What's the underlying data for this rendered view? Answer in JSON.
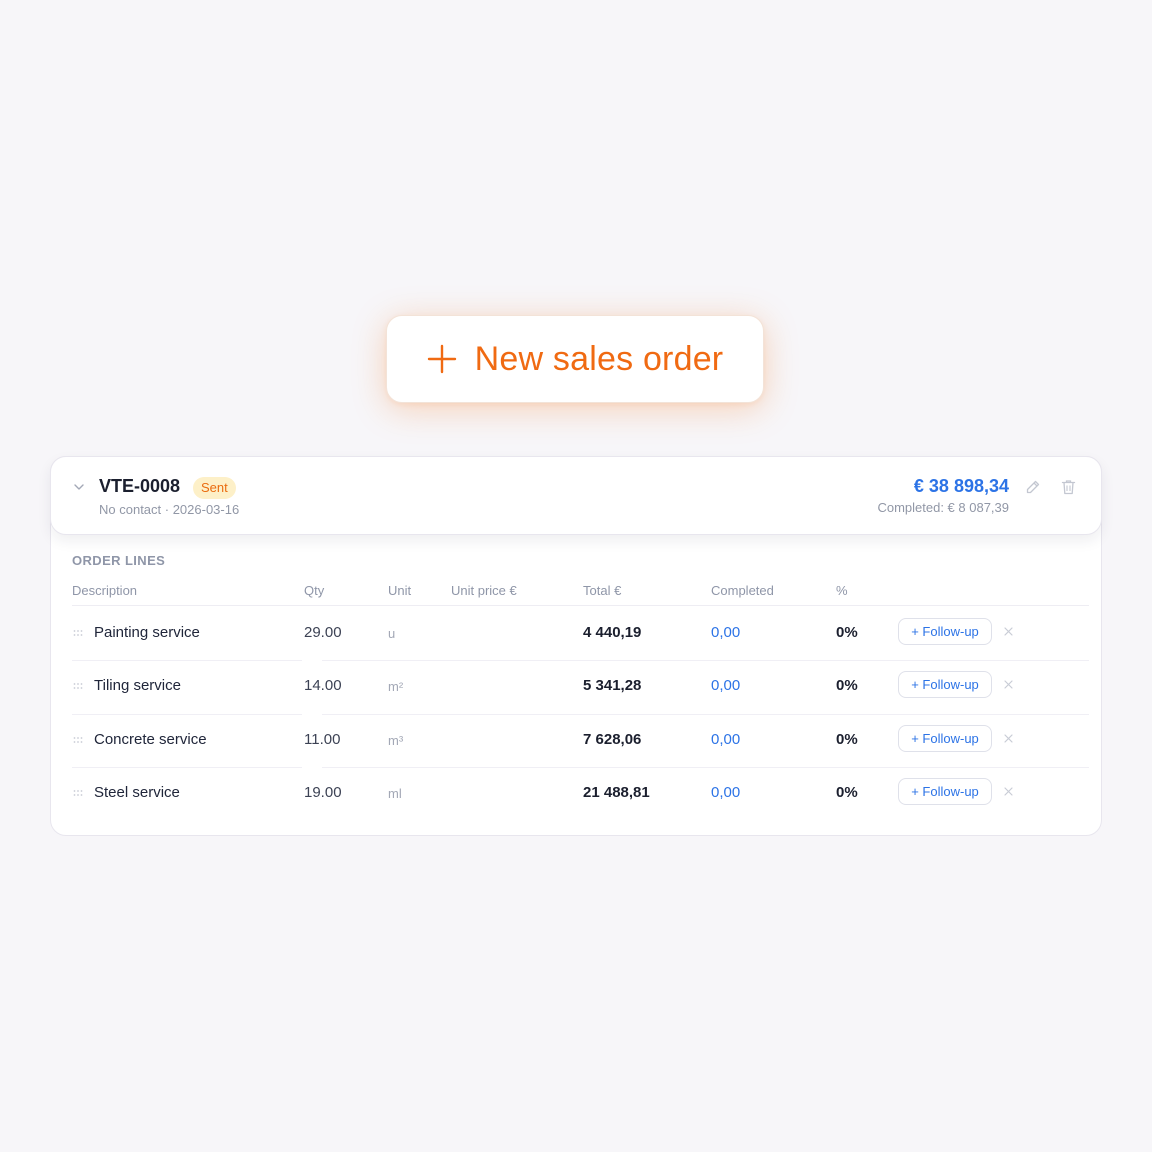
{
  "new_order_button": {
    "label": "New sales order",
    "icon": "plus-icon",
    "color": "#f06a12"
  },
  "order": {
    "id": "VTE-0008",
    "status": "Sent",
    "meta": "No contact · 2026-03-16",
    "total": "€ 38 898,34",
    "completed": "Completed: € 8 087,39",
    "section_title": "ORDER LINES",
    "columns": {
      "description": "Description",
      "qty": "Qty",
      "unit": "Unit",
      "unit_price": "Unit price €",
      "total": "Total €",
      "completed": "Completed",
      "percent": "%"
    },
    "lines": [
      {
        "description": "Painting service",
        "qty": "29.00",
        "unit": "u",
        "total": "4 440,19",
        "completed": "0,00",
        "percent": "0%",
        "action": "+ Follow-up"
      },
      {
        "description": "Tiling service",
        "qty": "14.00",
        "unit": "m²",
        "total": "5 341,28",
        "completed": "0,00",
        "percent": "0%",
        "action": "+ Follow-up"
      },
      {
        "description": "Concrete service",
        "qty": "11.00",
        "unit": "m³",
        "total": "7 628,06",
        "completed": "0,00",
        "percent": "0%",
        "action": "+ Follow-up"
      },
      {
        "description": "Steel service",
        "qty": "19.00",
        "unit": "ml",
        "total": "21 488,81",
        "completed": "0,00",
        "percent": "0%",
        "action": "+ Follow-up"
      }
    ]
  },
  "colors": {
    "accent_blue": "#2c73e6",
    "accent_orange": "#f06a12",
    "badge_bg": "#fdf0c8"
  }
}
